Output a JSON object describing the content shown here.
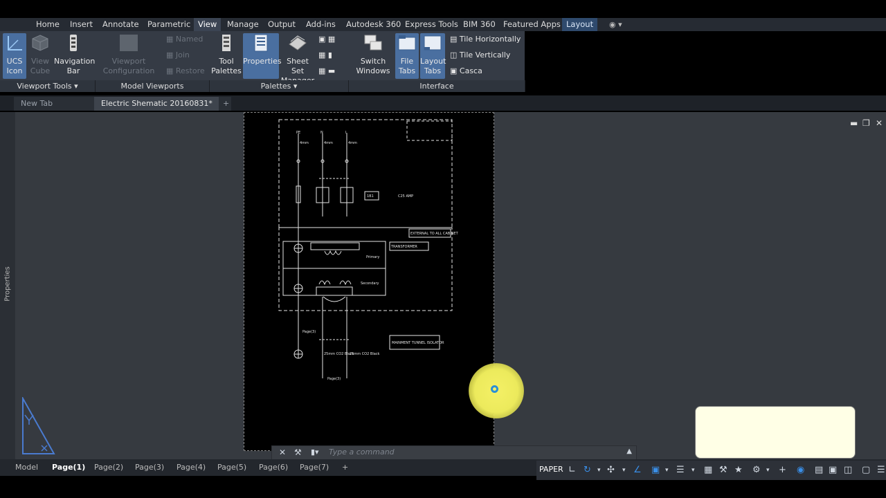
{
  "menubar": {
    "items": [
      "Home",
      "Insert",
      "Annotate",
      "Parametric",
      "View",
      "Manage",
      "Output",
      "Add-ins",
      "Autodesk 360",
      "Express Tools",
      "BIM 360",
      "Featured Apps",
      "Layout"
    ],
    "active": "View"
  },
  "ribbon": {
    "viewport_tools": {
      "ucs_icon": "UCS Icon",
      "view_cube": "View Cube",
      "navigation_bar": "Navigation Bar",
      "footer": "Viewport Tools"
    },
    "model_viewports": {
      "viewport_configuration": "Viewport Configuration",
      "named": "Named",
      "join": "Join",
      "restore": "Restore",
      "footer": "Model Viewports"
    },
    "palettes": {
      "tool_palettes": "Tool Palettes",
      "properties": "Properties",
      "sheet_set_manager": "Sheet Set Manager",
      "footer": "Palettes"
    },
    "interface": {
      "switch_windows": "Switch Windows",
      "file_tabs": "File Tabs",
      "layout_tabs": "Layout Tabs",
      "tile_horizontally": "Tile Horizontally",
      "tile_vertically": "Tile Vertically",
      "cascade": "Casca",
      "footer": "Interface"
    }
  },
  "doc_tabs": [
    "New Tab",
    "Electric Shematic 20160831*"
  ],
  "side_panel": {
    "label": "Properties"
  },
  "drawing": {
    "labels": {
      "pe": "PE",
      "n": "N",
      "l": "L",
      "size_4mm_1": "4mm",
      "size_4mm_2": "4mm",
      "size_4mm_3": "4mm",
      "breaker": "C25 AMP",
      "breaker_tag": "1B1",
      "external": "EXTERNAL TO ALL CABINET",
      "transformer": "TRANSFORMER",
      "primary": "Primary",
      "secondary": "Secondary",
      "isolator": "MAINMENT TUNNEL ISOLATOR",
      "page_ref_1": "Page(3)",
      "page_ref_2": "Page(3)",
      "cable_left": "25mm CO2 Black",
      "cable_right": "25mm CO2 Black"
    }
  },
  "command_line": {
    "placeholder": "Type a command"
  },
  "layout_tabs": [
    "Model",
    "Page(1)",
    "Page(2)",
    "Page(3)",
    "Page(4)",
    "Page(5)",
    "Page(6)",
    "Page(7)"
  ],
  "active_layout": "Page(1)",
  "status": {
    "space": "PAPER"
  }
}
